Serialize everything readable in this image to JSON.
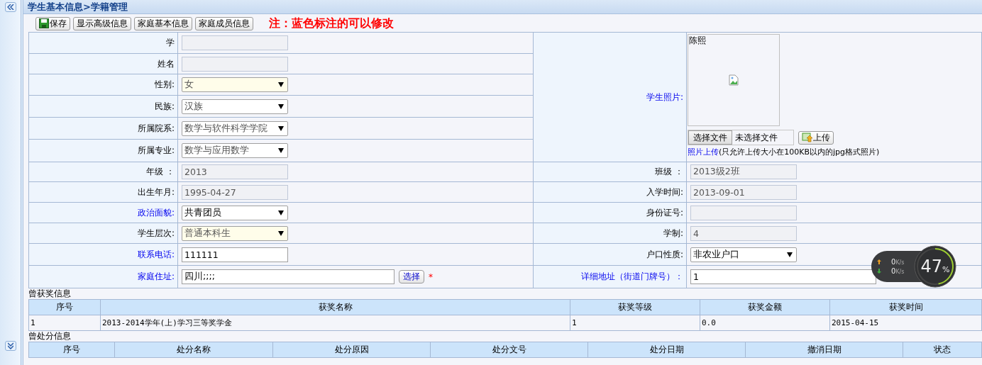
{
  "breadcrumb": "学生基本信息>学籍管理",
  "toolbar": {
    "buttons": [
      {
        "label": "保存",
        "icon": true
      },
      {
        "label": "显示高级信息",
        "icon": false
      },
      {
        "label": "家庭基本信息",
        "icon": false
      },
      {
        "label": "家庭成员信息",
        "icon": false
      }
    ],
    "note": "注：蓝色标注的可以修改"
  },
  "form": {
    "left_rows": [
      {
        "label": "学",
        "editable": false,
        "field": {
          "kind": "text",
          "disabled": true,
          "highlighted": false
        }
      },
      {
        "label": "姓名",
        "editable": false,
        "field": {
          "kind": "text",
          "disabled": true,
          "highlighted": false
        }
      },
      {
        "label": "性别:",
        "editable": false,
        "field": {
          "kind": "select",
          "value": "女",
          "disabled": true,
          "highlighted": true
        }
      },
      {
        "label": "民族:",
        "editable": false,
        "field": {
          "kind": "select",
          "value": "汉族",
          "disabled": true,
          "highlighted": false
        }
      },
      {
        "label": "所属院系:",
        "editable": false,
        "field": {
          "kind": "select",
          "value": "数学与软件科学学院",
          "disabled": true,
          "highlighted": false
        }
      },
      {
        "label": "所属专业:",
        "editable": false,
        "field": {
          "kind": "select",
          "value": "数学与应用数学",
          "disabled": true,
          "highlighted": false
        }
      },
      {
        "label": "年级 ：",
        "editable": false,
        "field": {
          "kind": "text",
          "value": "2013",
          "disabled": true,
          "highlighted": false
        }
      },
      {
        "label": "出生年月:",
        "editable": false,
        "field": {
          "kind": "text",
          "value": "1995-04-27",
          "disabled": true,
          "highlighted": false
        }
      },
      {
        "label": "政治面貌:",
        "editable": true,
        "field": {
          "kind": "select",
          "value": "共青团员",
          "disabled": false,
          "highlighted": false
        }
      },
      {
        "label": "学生层次:",
        "editable": false,
        "field": {
          "kind": "select",
          "value": "普通本科生",
          "disabled": true,
          "highlighted": true
        }
      },
      {
        "label": "联系电话:",
        "editable": true,
        "field": {
          "kind": "text",
          "value": "111111",
          "disabled": false,
          "highlighted": false
        }
      },
      {
        "label": "家庭住址:",
        "editable": true,
        "field": {
          "kind": "address",
          "value": "四川;;;;",
          "disabled": false,
          "highlighted": false,
          "button": "选择",
          "required_mark": "*"
        }
      }
    ],
    "photo": {
      "label": "学生照片:",
      "name": "陈熙",
      "choose_button": "选择文件",
      "file_status": "未选择文件",
      "upload_button": "上传",
      "upload_link": "照片上传",
      "upload_note": "(只允许上传大小在100KB以内的jpg格式照片)"
    },
    "right_rows": [
      {
        "label": "班级 ：",
        "editable": false,
        "field": {
          "kind": "text",
          "value": "2013级2班",
          "disabled": true,
          "highlighted": false
        }
      },
      {
        "label": "入学时间:",
        "editable": false,
        "field": {
          "kind": "text",
          "value": "2013-09-01",
          "disabled": true,
          "highlighted": false
        }
      },
      {
        "label": "身份证号:",
        "editable": false,
        "field": {
          "kind": "text",
          "disabled": true,
          "highlighted": false
        }
      },
      {
        "label": "学制:",
        "editable": false,
        "field": {
          "kind": "text",
          "value": "4",
          "disabled": true,
          "highlighted": false
        }
      },
      {
        "label": "户口性质:",
        "editable": false,
        "field": {
          "kind": "select",
          "value": "非农业户口",
          "disabled": false,
          "highlighted": false
        }
      },
      {
        "label": "详细地址（街道门牌号）：",
        "editable": true,
        "field": {
          "kind": "wide",
          "value": "1",
          "disabled": false,
          "highlighted": false
        }
      }
    ]
  },
  "awards": {
    "title": "曾获奖信息",
    "columns": [
      "序号",
      "获奖名称",
      "获奖等级",
      "获奖金额",
      "获奖时间"
    ],
    "rows": [
      [
        "1",
        "2013-2014学年(上)学习三等奖学金",
        "1",
        "0.0",
        "2015-04-15"
      ]
    ]
  },
  "punishments": {
    "title": "曾处分信息",
    "columns": [
      "序号",
      "处分名称",
      "处分原因",
      "处分文号",
      "处分日期",
      "撤消日期",
      "状态"
    ]
  },
  "net_widget": {
    "upload": "0",
    "download": "0",
    "unit_up": "K/s",
    "unit_down": "K/s",
    "percent": "47",
    "percent_sign": "%",
    "level": 0.47
  }
}
